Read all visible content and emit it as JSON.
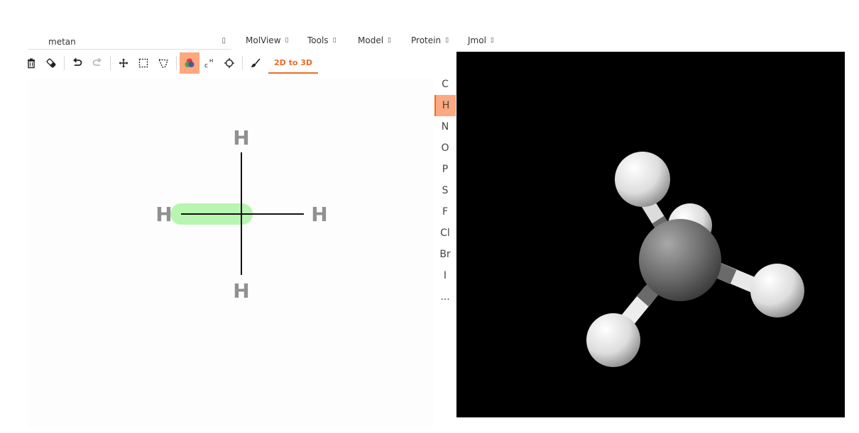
{
  "molecule": {
    "name": "metan"
  },
  "menus": [
    {
      "label": "MolView"
    },
    {
      "label": "Tools"
    },
    {
      "label": "Model"
    },
    {
      "label": "Protein"
    },
    {
      "label": "Jmol"
    }
  ],
  "toolbar": {
    "convert_label": "2D to 3D",
    "active_tool": "color-mode"
  },
  "elements": [
    "C",
    "H",
    "N",
    "O",
    "P",
    "S",
    "F",
    "Cl",
    "Br",
    "I",
    "..."
  ],
  "selected_element": "H",
  "structure2d": {
    "atoms": {
      "top": "H",
      "left": "H",
      "right": "H",
      "bottom": "H"
    }
  },
  "colors": {
    "accent": "#f06a24",
    "active_bg": "#fda87e",
    "selection_highlight": "#b8f5b0",
    "atom_label": "#909090",
    "viewer_bg": "#000000"
  }
}
